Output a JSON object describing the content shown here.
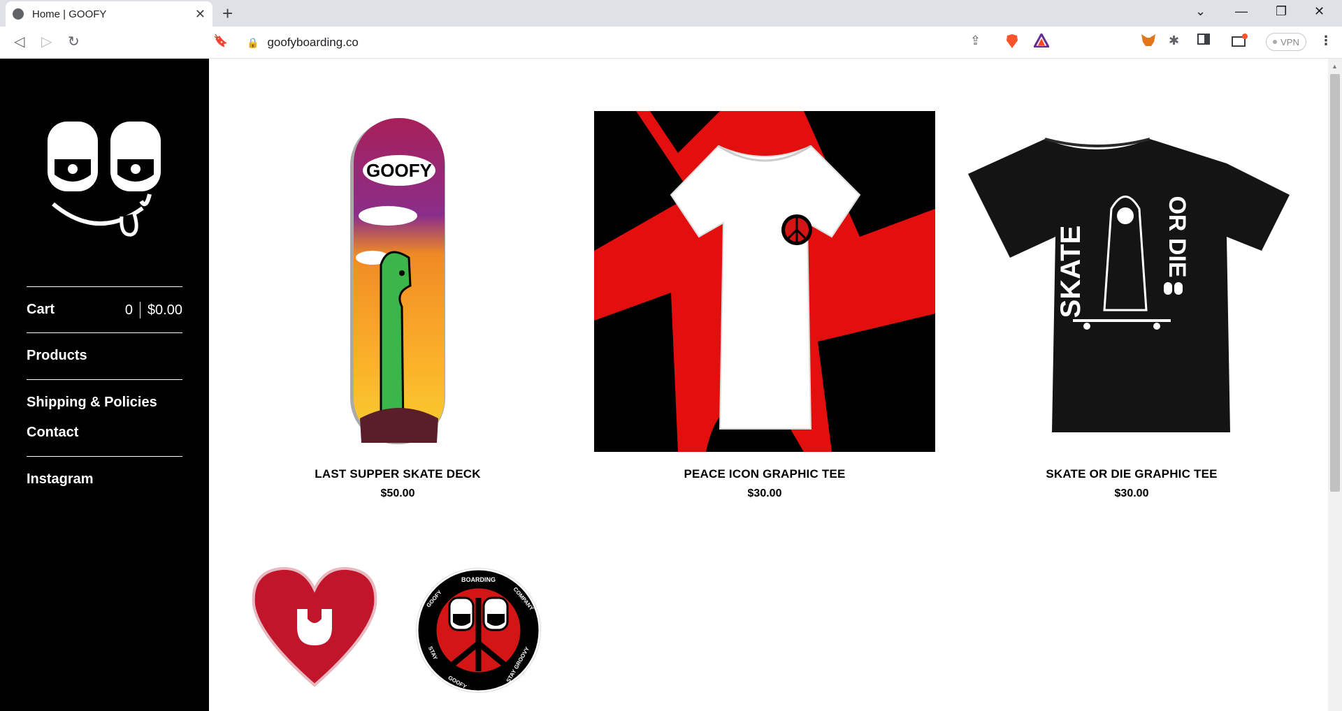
{
  "browser": {
    "tab_title": "Home | GOOFY",
    "tab_close": "✕",
    "new_tab": "+",
    "url": "goofyboarding.co",
    "vpn_label": "VPN",
    "win_minimize": "—",
    "win_restore": "❐",
    "win_close": "✕",
    "menu": "⋮",
    "chevron": "⌄"
  },
  "sidebar": {
    "cart_label": "Cart",
    "cart_count": "0",
    "cart_total": "$0.00",
    "nav": [
      {
        "label": "Products"
      },
      {
        "label": "Shipping & Policies"
      },
      {
        "label": "Contact"
      },
      {
        "label": "Instagram"
      }
    ]
  },
  "products": [
    {
      "name": "LAST SUPPER SKATE DECK",
      "price": "$50.00"
    },
    {
      "name": "PEACE ICON GRAPHIC TEE",
      "price": "$30.00"
    },
    {
      "name": "SKATE OR DIE GRAPHIC TEE",
      "price": "$30.00"
    }
  ],
  "graphics": {
    "deck_text": "GOOFY",
    "skate_text": "SKATE",
    "ordie_text": "OR DIE",
    "sticker_circle_top": "BOARDING",
    "sticker_circle_left": "GOOFY",
    "sticker_circle_right": "COMPANY",
    "sticker_circle_bl": "STAY",
    "sticker_circle_bottom": "GOOFY",
    "sticker_circle_br": "STAY GROOVY"
  },
  "colors": {
    "sidebar_bg": "#000000",
    "accent_red": "#d31515",
    "heart_red": "#c0152b"
  }
}
